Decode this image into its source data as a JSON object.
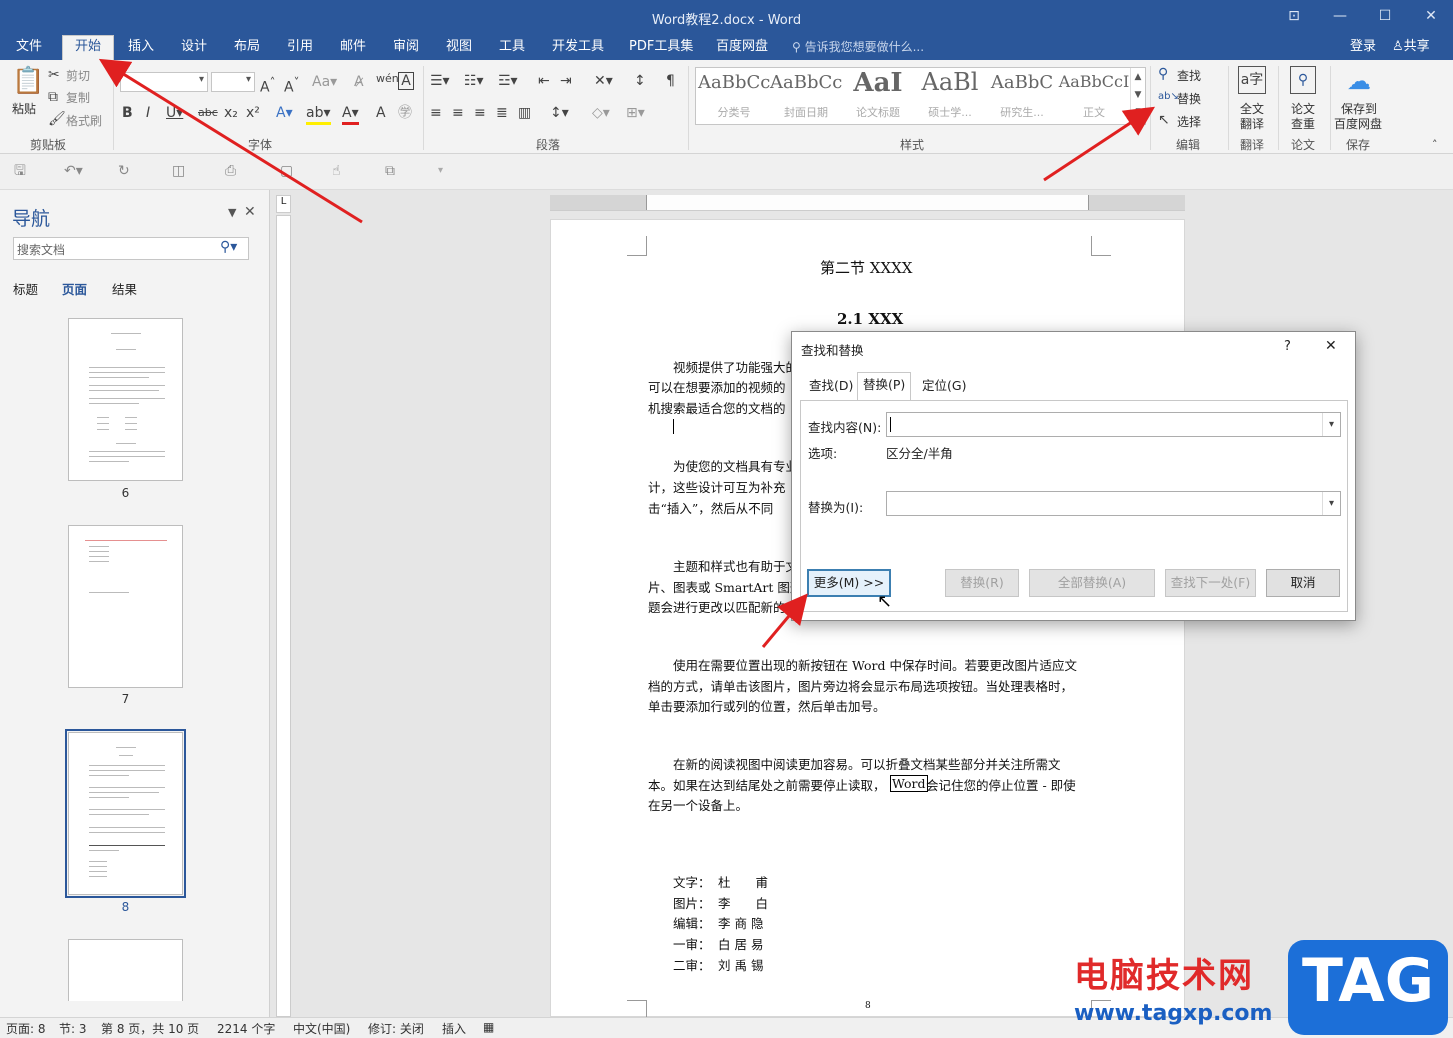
{
  "window": {
    "title": "Word教程2.docx - Word"
  },
  "menu": {
    "tabs": [
      "文件",
      "开始",
      "插入",
      "设计",
      "布局",
      "引用",
      "邮件",
      "审阅",
      "视图",
      "工具",
      "开发工具",
      "PDF工具集",
      "百度网盘"
    ],
    "tell_me": "告诉我您想要做什么...",
    "login": "登录",
    "share": "共享"
  },
  "ribbon": {
    "clipboard": {
      "paste": "粘贴",
      "cut": "剪切",
      "copy": "复制",
      "format_painter": "格式刷",
      "label": "剪贴板"
    },
    "font": {
      "label": "字体"
    },
    "paragraph": {
      "label": "段落"
    },
    "styles": {
      "label": "样式",
      "items": [
        {
          "preview": "AaBbCc",
          "name": "分类号"
        },
        {
          "preview": "AaBbCc",
          "name": "封面日期"
        },
        {
          "preview": "AaI",
          "name": "论文标题"
        },
        {
          "preview": "AaBl",
          "name": "硕士学..."
        },
        {
          "preview": "AaBbC",
          "name": "研究生..."
        },
        {
          "preview": "AaBbCcI",
          "name": "正文"
        }
      ]
    },
    "editing": {
      "find": "查找",
      "replace": "替换",
      "select": "选择",
      "label": "编辑"
    },
    "translate": {
      "full": "全文",
      "full2": "翻译",
      "label": "翻译"
    },
    "paper": {
      "check": "论文",
      "check2": "查重",
      "label": "论文"
    },
    "save": {
      "line1": "保存到",
      "line2": "百度网盘",
      "label": "保存"
    }
  },
  "nav": {
    "title": "导航",
    "search_placeholder": "搜索文档",
    "tabs": [
      "标题",
      "页面",
      "结果"
    ],
    "pages": [
      "6",
      "7",
      "8"
    ]
  },
  "document": {
    "heading1": "第二节  XXXX",
    "heading2": "2.1 XXX",
    "p1": [
      "视频提供了功能强大的",
      "可以在想要添加的视频的",
      "机搜索最适合您的文档的"
    ],
    "p2": [
      "为使您的文档具有专业",
      "计，这些设计可互为补充",
      "击“插入”，然后从不同"
    ],
    "p3": [
      "主题和样式也有助于文",
      "片、图表或 SmartArt 图形",
      "题会进行更改以匹配新的"
    ],
    "p4": [
      "使用在需要位置出现的新按钮在 Word 中保存时间。若要更改图片适应文",
      "档的方式，请单击该图片，图片旁边将会显示布局选项按钮。当处理表格时，",
      "单击要添加行或列的位置，然后单击加号。"
    ],
    "p5": [
      "在新的阅读视图中阅读更加容易。可以折叠文档某些部分并关注所需文",
      "本。如果在达到结尾处之前需要停止读取，",
      "Word",
      "会记住您的停止位置 - 即使",
      "在另一个设备上。"
    ],
    "credits": [
      {
        "role": "文字：",
        "name": "杜　　甫"
      },
      {
        "role": "图片：",
        "name": "李　　白"
      },
      {
        "role": "编辑：",
        "name": "李 商 隐"
      },
      {
        "role": "一审：",
        "name": "白 居 易"
      },
      {
        "role": "二审：",
        "name": "刘 禹 锡"
      }
    ],
    "page_number": "8"
  },
  "dialog": {
    "title": "查找和替换",
    "help": "?",
    "close": "✕",
    "tabs": [
      "查找(D)",
      "替换(P)",
      "定位(G)"
    ],
    "find_label": "查找内容(N):",
    "find_value": "",
    "options_label": "选项:",
    "options_value": "区分全/半角",
    "replace_label": "替换为(I):",
    "replace_value": "",
    "more": "更多(M) >>",
    "replace_btn": "替换(R)",
    "replace_all": "全部替换(A)",
    "find_next": "查找下一处(F)",
    "cancel": "取消"
  },
  "status": {
    "page": "页面: 8",
    "section": "节: 3",
    "page_of": "第 8 页，共 10 页",
    "words": "2214 个字",
    "lang": "中文(中国)",
    "track": "修订: 关闭",
    "insert": "插入"
  },
  "watermark": {
    "site": "电脑技术网",
    "url": "www.tagxp.com",
    "tag": "TAG"
  },
  "colors": {
    "accent": "#2b579a",
    "arrow": "#e02020"
  }
}
